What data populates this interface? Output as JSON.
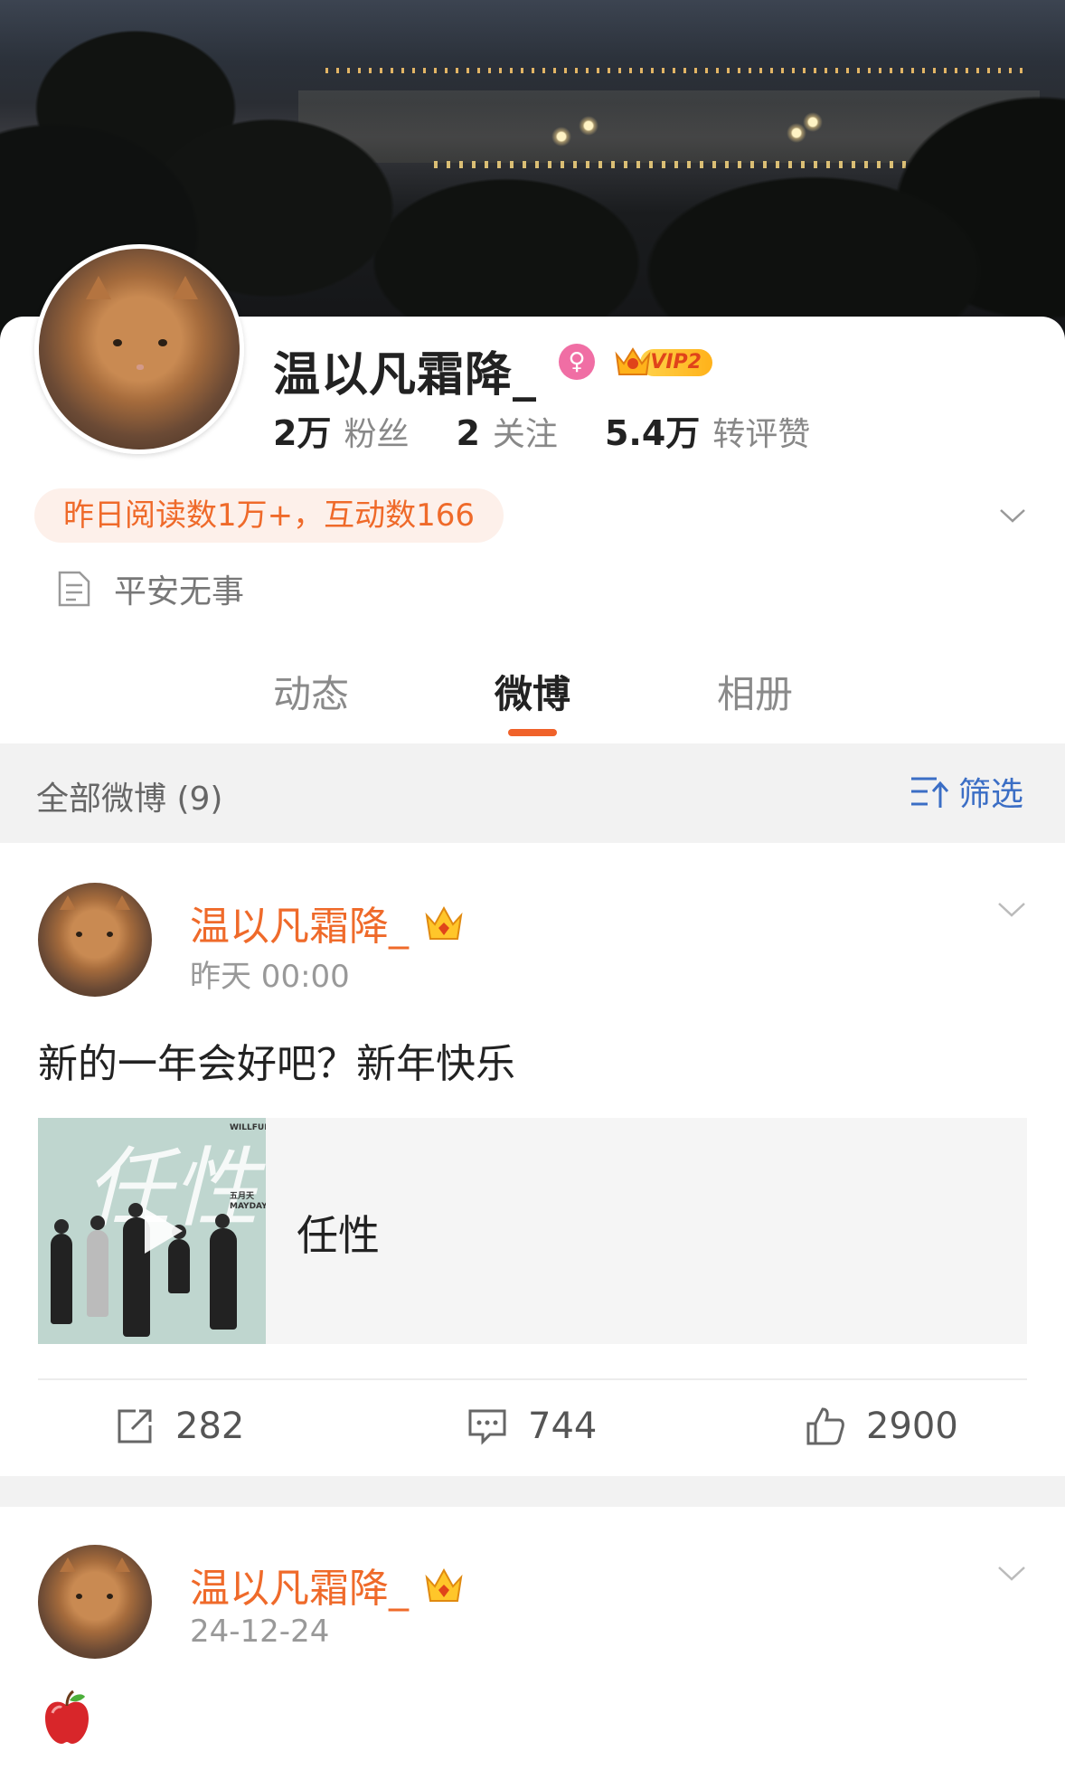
{
  "profile": {
    "name": "温以凡霜降_",
    "gender_symbol": "♀",
    "vip_label": "VIP2",
    "stats": [
      {
        "value": "2万",
        "label": "粉丝"
      },
      {
        "value": "2",
        "label": "关注"
      },
      {
        "value": "5.4万",
        "label": "转评赞"
      }
    ],
    "reading_pill": "昨日阅读数1万+，互动数166",
    "bio": "平安无事"
  },
  "tabs": [
    {
      "label": "动态",
      "active": false
    },
    {
      "label": "微博",
      "active": true
    },
    {
      "label": "相册",
      "active": false
    }
  ],
  "filter_bar": {
    "title": "全部微博 (9)",
    "filter_label": "筛选"
  },
  "posts": [
    {
      "author": "温以凡霜降_",
      "time": "昨天 00:00",
      "text": "新的一年会好吧？新年快乐",
      "music": {
        "song": "任性",
        "cover_text": "任性",
        "cover_brand": "WILLFUL",
        "cover_artist": "五月天 MAYDAY"
      },
      "reposts": "282",
      "comments": "744",
      "likes": "2900"
    },
    {
      "author": "温以凡霜降_",
      "time": "24-12-24",
      "text_icon": "apple-emoji"
    }
  ],
  "colors": {
    "accent": "#f0622a",
    "username": "#ef6a2a",
    "filter_blue": "#3b6ec5",
    "pill_bg": "#fdf0ea"
  }
}
